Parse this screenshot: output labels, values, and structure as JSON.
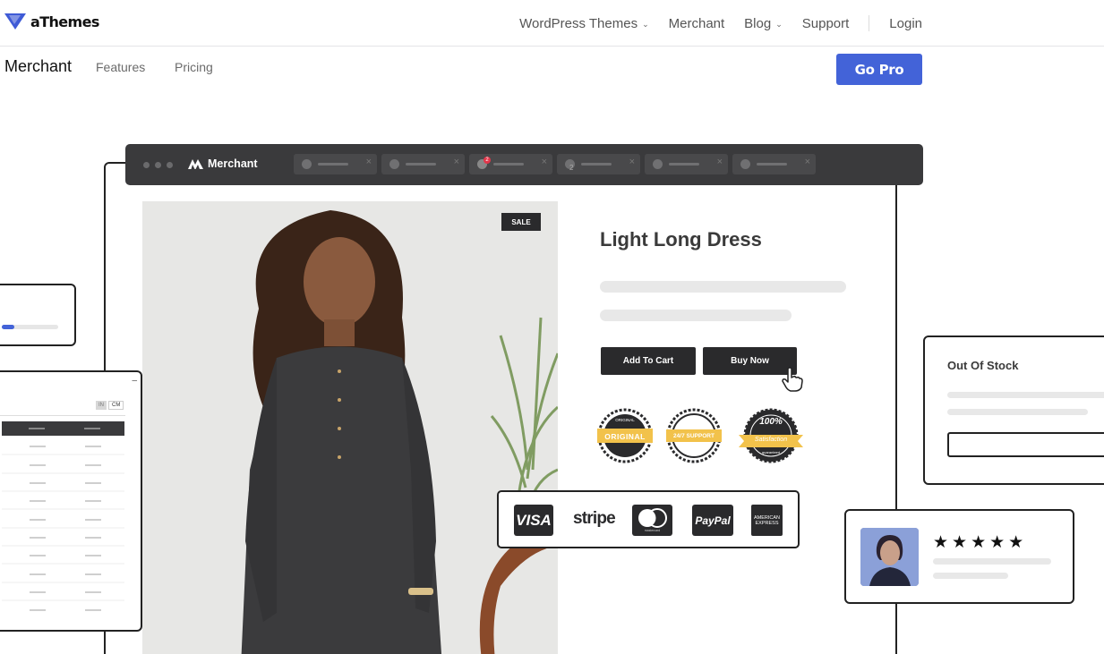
{
  "brand": {
    "name": "aThemes"
  },
  "nav": {
    "items": [
      {
        "label": "WordPress Themes",
        "has_dropdown": true
      },
      {
        "label": "Merchant",
        "has_dropdown": false
      },
      {
        "label": "Blog",
        "has_dropdown": true
      },
      {
        "label": "Support",
        "has_dropdown": false
      }
    ],
    "login": "Login",
    "chevron": "⌄"
  },
  "subnav": {
    "title": "Merchant",
    "links": [
      "Features",
      "Pricing"
    ],
    "cta": "Go Pro"
  },
  "mockup": {
    "browser_brand": "Merchant",
    "tab_badge": "2",
    "tab_sub": "2",
    "sale_badge": "SALE",
    "product_title": "Light Long Dress",
    "add_to_cart": "Add To Cart",
    "buy_now": "Buy Now",
    "trust_badges": [
      {
        "top": "ORIGINAL",
        "main": "ORIGINAL",
        "icon": "original-badge-icon"
      },
      {
        "top": "24/7",
        "main": "24/7 SUPPORT",
        "icon": "support-badge-icon"
      },
      {
        "top": "100%",
        "main": "Satisfaction",
        "sub": "guaranteed",
        "icon": "satisfaction-badge-icon"
      }
    ],
    "payments": {
      "visa": "VISA",
      "stripe": "stripe",
      "mastercard": "mastercard",
      "paypal": "PayPal",
      "amex": "AMERICAN EXPRESS"
    },
    "out_of_stock": "Out Of Stock",
    "review_stars": "★★★★★",
    "size_toggle": [
      "IN",
      "CM"
    ]
  },
  "colors": {
    "accent": "#4363d8",
    "dark": "#2a2a2c",
    "badge_gold": "#f2c24b"
  }
}
